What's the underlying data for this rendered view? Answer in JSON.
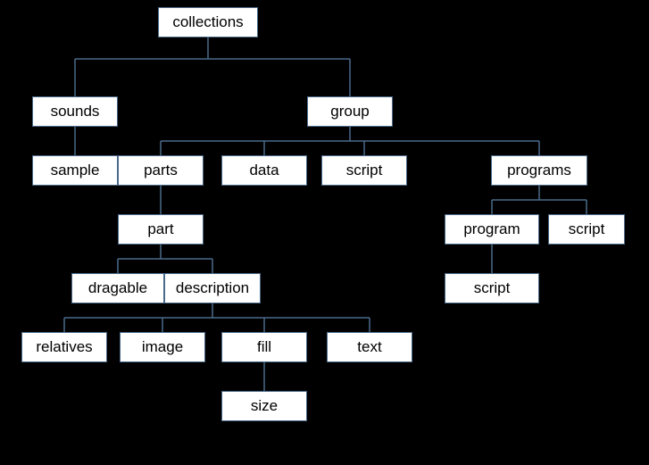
{
  "nodes": {
    "collections": "collections",
    "sounds": "sounds",
    "sample": "sample",
    "group": "group",
    "parts": "parts",
    "data": "data",
    "script1": "script",
    "programs": "programs",
    "part": "part",
    "program": "program",
    "script2": "script",
    "script3": "script",
    "dragable": "dragable",
    "description": "description",
    "relatives": "relatives",
    "image": "image",
    "fill": "fill",
    "text": "text",
    "size": "size"
  }
}
